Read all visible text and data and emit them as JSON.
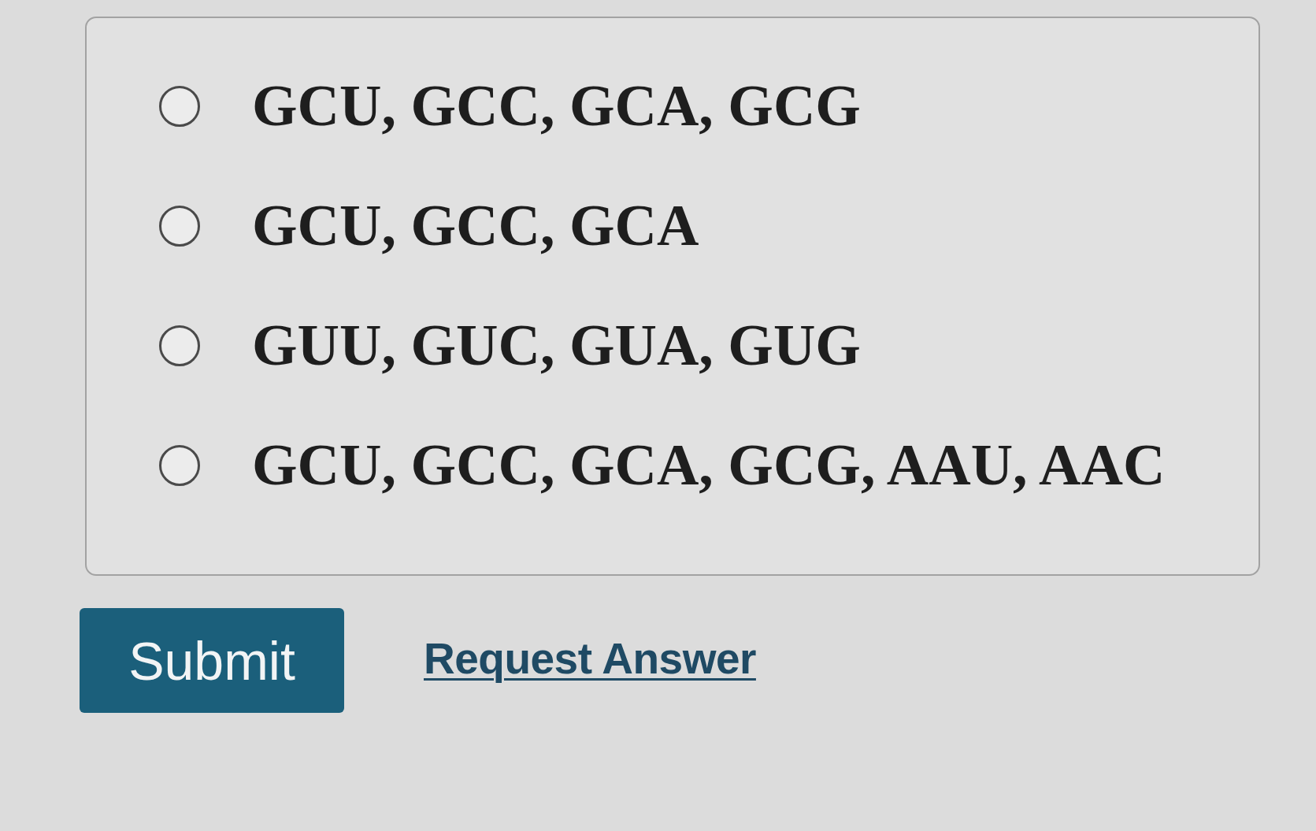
{
  "options": [
    {
      "label": "GCU, GCC, GCA, GCG",
      "selected": false
    },
    {
      "label": "GCU, GCC, GCA",
      "selected": false
    },
    {
      "label": "GUU, GUC, GUA, GUG",
      "selected": false
    },
    {
      "label": "GCU, GCC, GCA, GCG, AAU, AAC",
      "selected": false
    }
  ],
  "actions": {
    "submit": "Submit",
    "request_answer": "Request Answer"
  }
}
